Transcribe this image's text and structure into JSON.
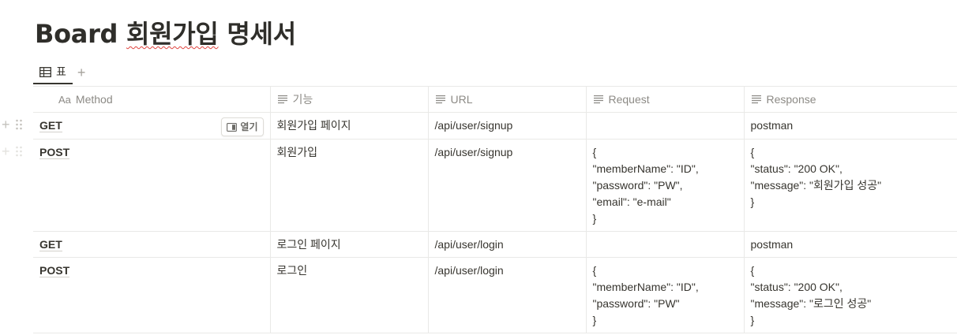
{
  "page": {
    "title_en": "Board",
    "title_ko_a": "회원가입",
    "title_ko_b": "명세서"
  },
  "view": {
    "tab_label": "표",
    "add_label": "+"
  },
  "table": {
    "title_prefix": "Aa",
    "columns": [
      "Method",
      "기능",
      "URL",
      "Request",
      "Response"
    ],
    "open_label": "열기",
    "rows": [
      {
        "method": "GET",
        "feature": "회원가입 페이지",
        "url": "/api/user/signup",
        "request": "",
        "response": "postman"
      },
      {
        "method": "POST",
        "feature": "회원가입",
        "url": "/api/user/signup",
        "request": "{\n\"memberName\": \"ID\",\n\"password\": \"PW\",\n\"email\": \"e-mail\"\n}",
        "response": "{\n\"status\": \"200 OK\",\n\"message\": \"회원가입 성공\"\n}"
      },
      {
        "method": "GET",
        "feature": "로그인 페이지",
        "url": "/api/user/login",
        "request": "",
        "response": "postman"
      },
      {
        "method": "POST",
        "feature": "로그인",
        "url": "/api/user/login",
        "request": "{\n\"memberName\": \"ID\",\n\"password\": \"PW\"\n}",
        "response": "{\n\"status\": \"200 OK\",\n\"message\": \"로그인 성공\"\n}"
      }
    ]
  }
}
